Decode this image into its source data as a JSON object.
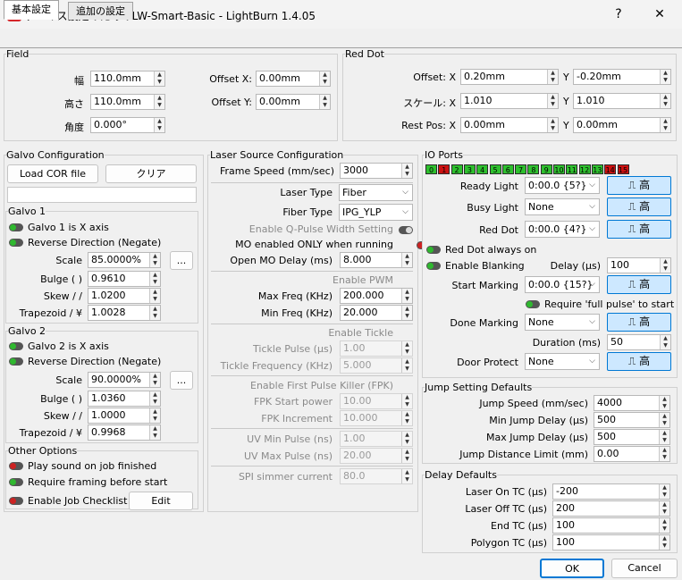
{
  "window": {
    "title": "デバイス設定のためのLW-Smart-Basic - LightBurn 1.4.05",
    "help": "?",
    "close": "✕"
  },
  "tabs": [
    "基本設定",
    "追加の設定"
  ],
  "field": {
    "title": "Field",
    "width_label": "幅",
    "width": "110.0mm",
    "height_label": "高さ",
    "height": "110.0mm",
    "angle_label": "角度",
    "angle": "0.000°",
    "offx_label": "Offset X:",
    "offx": "0.00mm",
    "offy_label": "Offset Y:",
    "offy": "0.00mm"
  },
  "reddot": {
    "title": "Red Dot",
    "offset_label": "Offset: X",
    "offset_x": "0.20mm",
    "offset_y_label": "Y",
    "offset_y": "-0.20mm",
    "scale_label": "スケール: X",
    "scale_x": "1.010",
    "scale_y_label": "Y",
    "scale_y": "1.010",
    "rest_label": "Rest Pos: X",
    "rest_x": "0.00mm",
    "rest_y_label": "Y",
    "rest_y": "0.00mm"
  },
  "galvo": {
    "title": "Galvo Configuration",
    "load_cor": "Load COR file",
    "clear": "クリア",
    "g1": {
      "title": "Galvo 1",
      "is_x": "Galvo 1 is X axis",
      "reverse": "Reverse Direction (Negate)",
      "scale_label": "Scale",
      "scale": "85.0000%",
      "more": "...",
      "bulge_label": "Bulge ( )",
      "bulge": "0.9610",
      "skew_label": "Skew / /",
      "skew": "1.0200",
      "trap_label": "Trapezoid / ¥",
      "trap": "1.0028"
    },
    "g2": {
      "title": "Galvo 2",
      "is_x": "Galvo 2 is X axis",
      "reverse": "Reverse Direction (Negate)",
      "scale_label": "Scale",
      "scale": "90.0000%",
      "more": "...",
      "bulge_label": "Bulge ( )",
      "bulge": "1.0360",
      "skew_label": "Skew / /",
      "skew": "1.0000",
      "trap_label": "Trapezoid / ¥",
      "trap": "0.9968"
    }
  },
  "other": {
    "title": "Other Options",
    "sound": "Play sound on job finished",
    "framing": "Require framing before start",
    "checklist": "Enable Job Checklist",
    "edit": "Edit"
  },
  "laser": {
    "title": "Laser Source Configuration",
    "frame_speed_label": "Frame Speed (mm/sec)",
    "frame_speed": "3000",
    "type_label": "Laser Type",
    "type": "Fiber",
    "fiber_label": "Fiber Type",
    "fiber": "IPG_YLP",
    "qpulse": "Enable Q-Pulse Width Setting",
    "mo_only": "MO enabled ONLY when running",
    "mo_delay_label": "Open MO Delay (ms)",
    "mo_delay": "8.000",
    "pwm": "Enable PWM",
    "maxfreq_label": "Max Freq (KHz)",
    "maxfreq": "200.000",
    "minfreq_label": "Min Freq (KHz)",
    "minfreq": "20.000",
    "tickle": "Enable Tickle",
    "tickle_pulse_label": "Tickle Pulse (μs)",
    "tickle_pulse": "1.00",
    "tickle_freq_label": "Tickle Frequency (KHz)",
    "tickle_freq": "5.000",
    "fpk": "Enable First Pulse Killer (FPK)",
    "fpk_power_label": "FPK Start power",
    "fpk_power": "10.00",
    "fpk_inc_label": "FPK Increment",
    "fpk_inc": "10.000",
    "uvmin_label": "UV Min Pulse (ns)",
    "uvmin": "1.00",
    "uvmax_label": "UV Max Pulse (ns)",
    "uvmax": "20.00",
    "spi_label": "SPI simmer current",
    "spi": "80.0"
  },
  "io": {
    "title": "IO Ports",
    "ports": [
      "0",
      "1",
      "2",
      "3",
      "4",
      "5",
      "6",
      "7",
      "8",
      "9",
      "10",
      "11",
      "12",
      "13",
      "14",
      "15"
    ],
    "port_states": [
      "g",
      "r",
      "g",
      "g",
      "g",
      "g",
      "g",
      "g",
      "g",
      "g",
      "g",
      "g",
      "g",
      "g",
      "r",
      "r"
    ],
    "ready_label": "Ready Light",
    "ready": "0:00.0 {5?}",
    "busy_label": "Busy Light",
    "busy": "None",
    "reddot_label": "Red Dot",
    "reddot": "0:00.0 {4?}",
    "pulse": "⎍ 高",
    "always_on": "Red Dot always on",
    "blanking": "Enable Blanking",
    "delay_label": "Delay (μs)",
    "delay": "100",
    "start_label": "Start Marking",
    "start": "0:00.0 {15?}",
    "full_pulse": "Require 'full pulse' to start",
    "done_label": "Done Marking",
    "done": "None",
    "duration_label": "Duration (ms)",
    "duration": "50",
    "door_label": "Door Protect",
    "door": "None"
  },
  "jump": {
    "title": "Jump Setting Defaults",
    "speed_label": "Jump Speed (mm/sec)",
    "speed": "4000",
    "min_label": "Min Jump Delay (μs)",
    "min": "500",
    "max_label": "Max Jump Delay (μs)",
    "max": "500",
    "limit_label": "Jump Distance Limit (mm)",
    "limit": "0.00"
  },
  "delay": {
    "title": "Delay Defaults",
    "on_label": "Laser On TC (μs)",
    "on": "-200",
    "off_label": "Laser Off TC (μs)",
    "off": "200",
    "end_label": "End TC (μs)",
    "end": "100",
    "poly_label": "Polygon TC (μs)",
    "poly": "100"
  },
  "footer": {
    "ok": "OK",
    "cancel": "Cancel"
  }
}
